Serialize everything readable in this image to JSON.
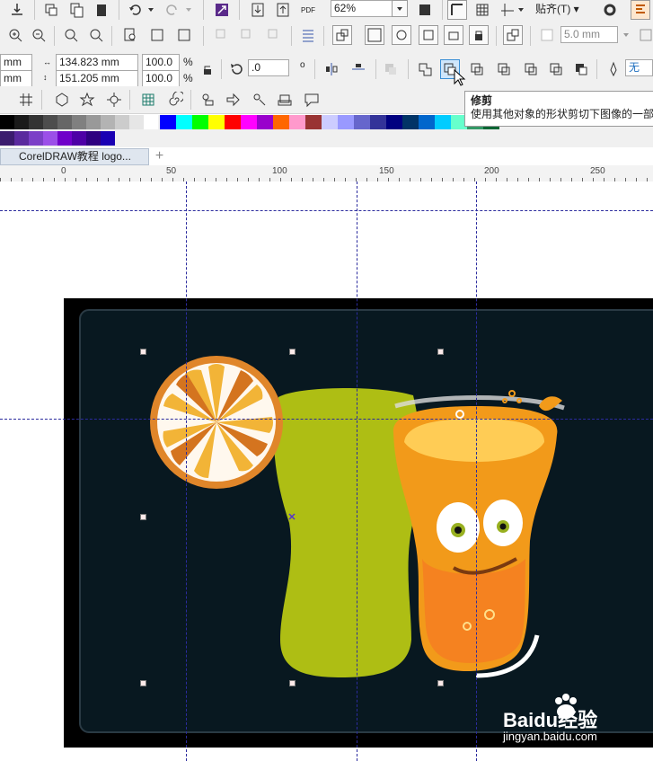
{
  "toolbar_top": {
    "zoom_value": "62%",
    "snap_label": "贴齐(T)",
    "pdf_label": "PDF"
  },
  "toolbar_mid": {
    "outline_width": "5.0 mm"
  },
  "property_bar": {
    "x_partial": "mm",
    "y_partial": "mm",
    "width": "134.823 mm",
    "height": "151.205 mm",
    "scale_x": "100.0",
    "scale_y": "100.0",
    "percent": "%",
    "rotation": ".0",
    "degree": "o",
    "fill_label": "无"
  },
  "tooltip": {
    "title": "修剪",
    "description": "使用其他对象的形状剪切下图像的一部分"
  },
  "document_tab": {
    "label": "CorelDRAW教程 logo..."
  },
  "ruler": {
    "labels": [
      "0",
      "50",
      "100",
      "150",
      "200",
      "250"
    ]
  },
  "palette": {
    "grays": [
      "#000000",
      "#1a1a1a",
      "#333333",
      "#4d4d4d",
      "#666666",
      "#808080",
      "#999999",
      "#b3b3b3",
      "#cccccc",
      "#e6e6e6"
    ],
    "row2_left": [
      "#3b1c6e",
      "#5a2a9e",
      "#7b3fc7",
      "#9b4fe8",
      "#6f00c9",
      "#4d00a6",
      "#2e0080",
      "#1a00b3"
    ],
    "colors": [
      "#0000ff",
      "#00ffff",
      "#00ff00",
      "#ffff00",
      "#ff0000",
      "#ff00ff",
      "#9900cc",
      "#ff6600",
      "#ff99cc",
      "#993333",
      "#ccccff",
      "#9999ff",
      "#6666cc",
      "#333399",
      "#000080",
      "#003366",
      "#0066cc",
      "#00ccff",
      "#66ffcc",
      "#339966",
      "#006633"
    ]
  },
  "canvas": {
    "bg_color": "#000000",
    "panel_color": "#081820",
    "bottle_color": "#aebe14",
    "orange_color": "#f0a020"
  },
  "watermark": {
    "brand": "Baidu经验",
    "url": "jingyan.baidu.com"
  }
}
